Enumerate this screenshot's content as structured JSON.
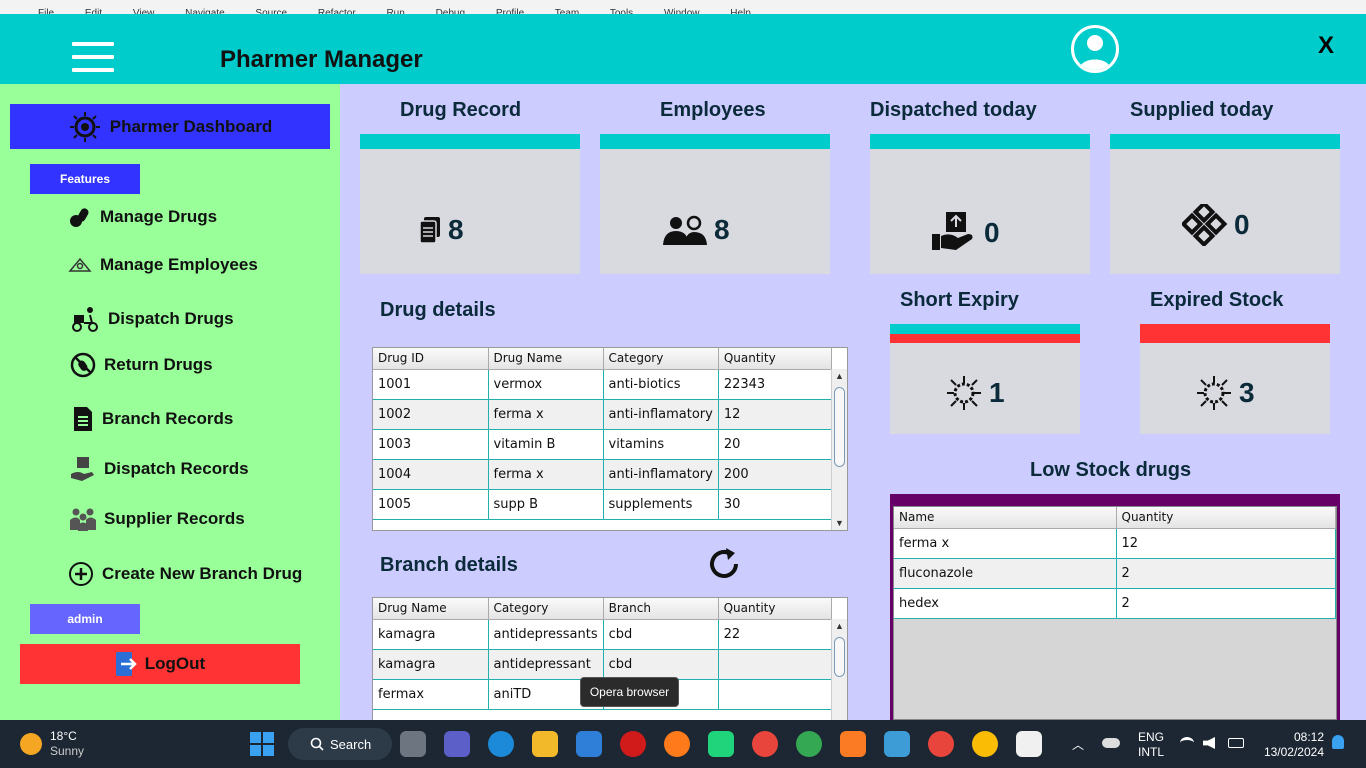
{
  "ide_menu": [
    "File",
    "Edit",
    "View",
    "Navigate",
    "Source",
    "Refactor",
    "Run",
    "Debug",
    "Profile",
    "Team",
    "Tools",
    "Window",
    "Help"
  ],
  "header": {
    "title": "Pharmer Manager",
    "close_label": "X"
  },
  "sidebar": {
    "dashboard_label": "Pharmer Dashboard",
    "features_tag": "Features",
    "items": [
      {
        "label": "Manage Drugs",
        "icon": "pills-icon"
      },
      {
        "label": "Manage Employees",
        "icon": "employees-icon"
      },
      {
        "label": "Dispatch Drugs",
        "icon": "delivery-scooter-icon"
      },
      {
        "label": "Return Drugs",
        "icon": "no-pills-icon"
      },
      {
        "label": "Branch Records",
        "icon": "document-icon"
      },
      {
        "label": "Dispatch Records",
        "icon": "hand-box-icon"
      },
      {
        "label": "Supplier Records",
        "icon": "suppliers-icon"
      },
      {
        "label": "Create New Branch Drug",
        "icon": "plus-circle-icon"
      }
    ],
    "admin_tag": "admin",
    "logout_label": "LogOut"
  },
  "stats": [
    {
      "title": "Drug Record",
      "value": "8"
    },
    {
      "title": "Employees",
      "value": "8"
    },
    {
      "title": "Dispatched today",
      "value": "0"
    },
    {
      "title": "Supplied today",
      "value": "0"
    }
  ],
  "expiry": [
    {
      "title": "Short Expiry",
      "value": "1"
    },
    {
      "title": "Expired Stock",
      "value": "3"
    }
  ],
  "drug_details": {
    "title": "Drug details",
    "columns": [
      "Drug ID",
      "Drug Name",
      "Category",
      "Quantity"
    ],
    "rows": [
      [
        "1001",
        "vermox",
        "anti-biotics",
        "22343"
      ],
      [
        "1002",
        "ferma x",
        "anti-inflamatory",
        "12"
      ],
      [
        "1003",
        "vitamin B",
        "vitamins",
        "20"
      ],
      [
        "1004",
        "ferma x",
        "anti-inflamatory",
        "200"
      ],
      [
        "1005",
        "supp B",
        "supplements",
        "30"
      ]
    ]
  },
  "branch_details": {
    "title": "Branch details",
    "columns": [
      "Drug Name",
      "Category",
      "Branch",
      "Quantity"
    ],
    "rows": [
      [
        "kamagra",
        "antidepressants",
        "cbd",
        "22"
      ],
      [
        "kamagra",
        "antidepressant",
        "cbd",
        ""
      ],
      [
        "fermax",
        "aniTD",
        "",
        ""
      ]
    ]
  },
  "low_stock": {
    "title": "Low Stock drugs",
    "columns": [
      "Name",
      "Quantity"
    ],
    "rows": [
      [
        "ferma x",
        "12"
      ],
      [
        "fluconazole",
        "2"
      ],
      [
        "hedex",
        "2"
      ]
    ]
  },
  "tooltip": "Opera browser",
  "taskbar": {
    "weather_temp": "18°C",
    "weather_desc": "Sunny",
    "search_label": "Search",
    "lang_top": "ENG",
    "lang_bottom": "INTL",
    "time": "08:12",
    "date": "13/02/2024"
  },
  "colors": {
    "header": "#00cccc",
    "sidebar": "#99ff99",
    "main": "#ccccff",
    "dashboard": "#3333ff",
    "logout": "#ff3333",
    "expired": "#ff3333",
    "low_stock_frame": "#660066"
  }
}
